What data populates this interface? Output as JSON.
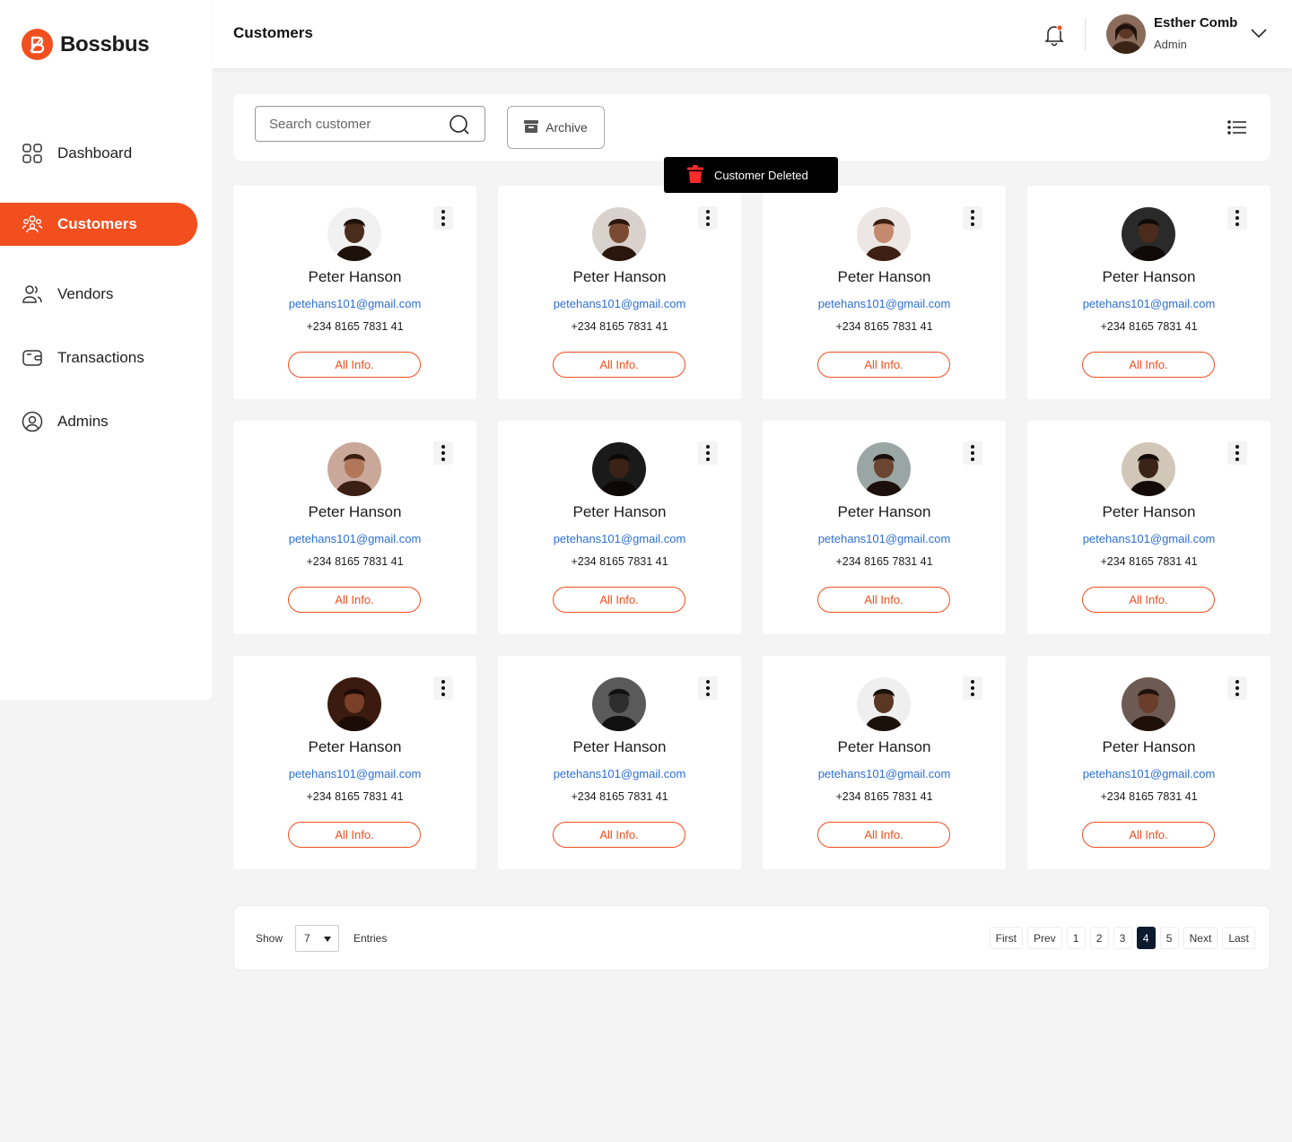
{
  "brand": {
    "name": "Bossbus",
    "accent": "#f24e1e"
  },
  "sidebar": {
    "items": [
      {
        "label": "Dashboard",
        "icon": "grid-icon",
        "active": false
      },
      {
        "label": "Customers",
        "icon": "users-group-icon",
        "active": true
      },
      {
        "label": "Vendors",
        "icon": "users-icon",
        "active": false
      },
      {
        "label": "Transactions",
        "icon": "wallet-icon",
        "active": false
      },
      {
        "label": "Admins",
        "icon": "user-circle-icon",
        "active": false
      }
    ]
  },
  "header": {
    "title": "Customers",
    "user": {
      "name": "Esther Comb",
      "role": "Admin"
    }
  },
  "toolbar": {
    "search_placeholder": "Search customer",
    "archive_label": "Archive"
  },
  "toast": {
    "message": "Customer Deleted"
  },
  "customers": [
    {
      "name": "Peter Hanson",
      "email": "petehans101@gmail.com",
      "phone": "+234 8165 7831 41",
      "action": "All Info."
    },
    {
      "name": "Peter Hanson",
      "email": "petehans101@gmail.com",
      "phone": "+234 8165 7831 41",
      "action": "All Info."
    },
    {
      "name": "Peter Hanson",
      "email": "petehans101@gmail.com",
      "phone": "+234 8165 7831 41",
      "action": "All Info."
    },
    {
      "name": "Peter Hanson",
      "email": "petehans101@gmail.com",
      "phone": "+234 8165 7831 41",
      "action": "All Info."
    },
    {
      "name": "Peter Hanson",
      "email": "petehans101@gmail.com",
      "phone": "+234 8165 7831 41",
      "action": "All Info."
    },
    {
      "name": "Peter Hanson",
      "email": "petehans101@gmail.com",
      "phone": "+234 8165 7831 41",
      "action": "All Info."
    },
    {
      "name": "Peter Hanson",
      "email": "petehans101@gmail.com",
      "phone": "+234 8165 7831 41",
      "action": "All Info."
    },
    {
      "name": "Peter Hanson",
      "email": "petehans101@gmail.com",
      "phone": "+234 8165 7831 41",
      "action": "All Info."
    },
    {
      "name": "Peter Hanson",
      "email": "petehans101@gmail.com",
      "phone": "+234 8165 7831 41",
      "action": "All Info."
    },
    {
      "name": "Peter Hanson",
      "email": "petehans101@gmail.com",
      "phone": "+234 8165 7831 41",
      "action": "All Info."
    },
    {
      "name": "Peter Hanson",
      "email": "petehans101@gmail.com",
      "phone": "+234 8165 7831 41",
      "action": "All Info."
    },
    {
      "name": "Peter Hanson",
      "email": "petehans101@gmail.com",
      "phone": "+234 8165 7831 41",
      "action": "All Info."
    }
  ],
  "pagination": {
    "show_label": "Show",
    "entries_value": "7",
    "entries_label": "Entries",
    "buttons": [
      "First",
      "Prev",
      "1",
      "2",
      "3",
      "4",
      "5",
      "Next",
      "Last"
    ],
    "current": "4"
  }
}
